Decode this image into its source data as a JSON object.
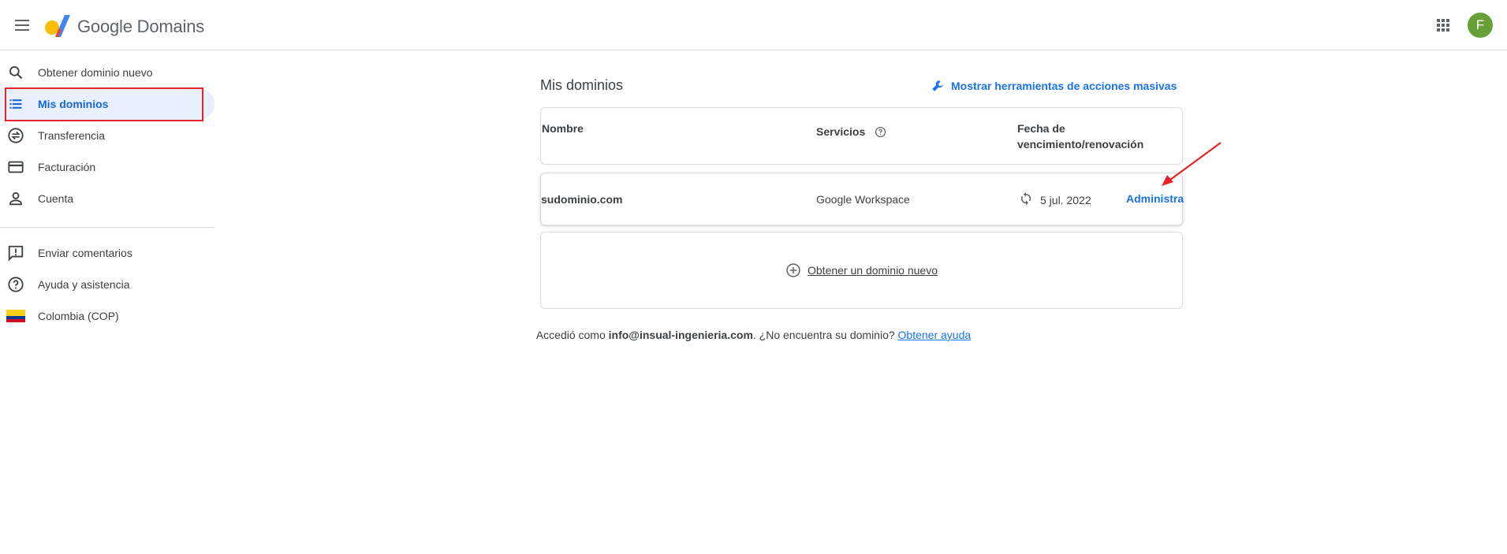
{
  "header": {
    "brand_google": "Google",
    "brand_domains": "Domains",
    "avatar_letter": "F",
    "avatar_color": "#689f38"
  },
  "sidebar": {
    "items": [
      {
        "label": "Obtener dominio nuevo",
        "icon": "search-icon"
      },
      {
        "label": "Mis dominios",
        "icon": "list-icon",
        "active": true
      },
      {
        "label": "Transferencia",
        "icon": "transfer-icon"
      },
      {
        "label": "Facturación",
        "icon": "credit-card-icon"
      },
      {
        "label": "Cuenta",
        "icon": "person-icon"
      }
    ],
    "secondary": [
      {
        "label": "Enviar comentarios",
        "icon": "feedback-icon"
      },
      {
        "label": "Ayuda y asistencia",
        "icon": "help-icon"
      },
      {
        "label": "Colombia (COP)",
        "icon": "colombia-flag-icon"
      }
    ]
  },
  "main": {
    "title": "Mis dominios",
    "bulk_tools_label": "Mostrar herramientas de acciones masivas",
    "columns": {
      "name": "Nombre",
      "services": "Servicios",
      "expiry_line1": "Fecha de",
      "expiry_line2": "vencimiento/renovación"
    },
    "rows": [
      {
        "domain": "sudominio.com",
        "service": "Google Workspace",
        "date": "5 jul. 2022",
        "action": "Administra"
      }
    ],
    "new_domain_label": "Obtener un dominio nuevo",
    "footer": {
      "prefix": "Accedió como",
      "email": "info@insual-ingenieria.com",
      "middle": ". ¿No encuentra su dominio?",
      "help_link": "Obtener ayuda"
    }
  },
  "colors": {
    "accent": "#1a73e8",
    "active_bg": "#e8f0fe",
    "annotation_red": "#e8222a"
  }
}
